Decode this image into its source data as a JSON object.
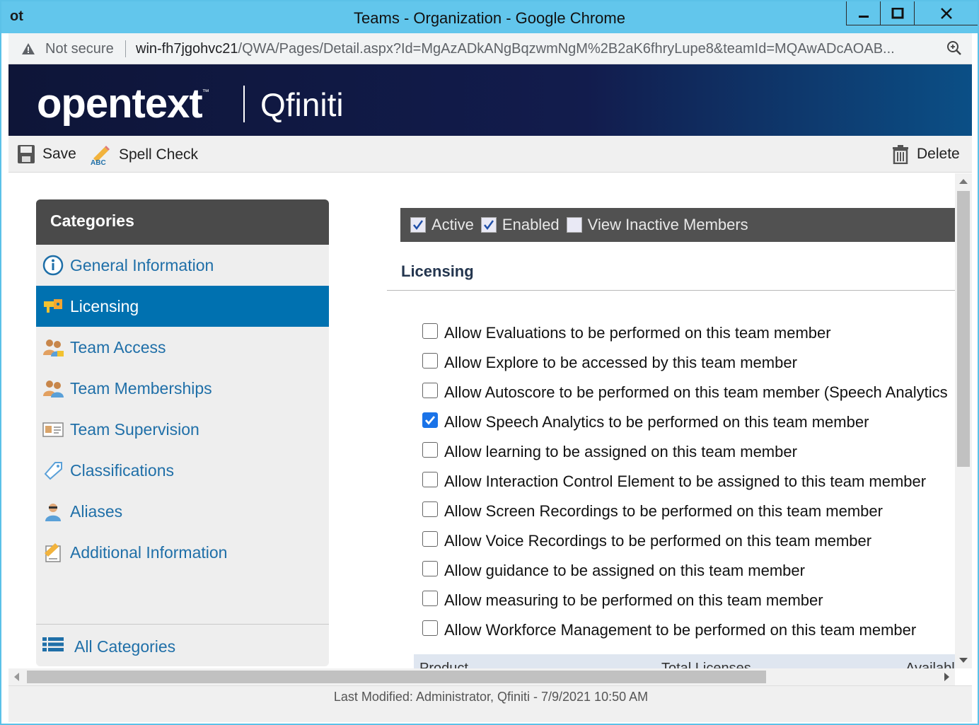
{
  "window": {
    "app_logo": "ot",
    "title": "Teams - Organization - Google Chrome"
  },
  "address": {
    "security_label": "Not secure",
    "url_host": "win-fh7jgohvc21",
    "url_path": "/QWA/Pages/Detail.aspx?Id=MgAzADkANgBqzwmNgM%2B2aK6fhryLupe8&teamId=MQAwADcAOAB..."
  },
  "brand": {
    "name": "opentext",
    "tm": "™",
    "product": "Qfiniti"
  },
  "toolbar": {
    "save_label": "Save",
    "spell_label": "Spell Check",
    "delete_label": "Delete"
  },
  "categories": {
    "header": "Categories",
    "items": [
      {
        "label": "General Information",
        "icon": "info-icon"
      },
      {
        "label": "Licensing",
        "icon": "license-key-icon",
        "active": true
      },
      {
        "label": "Team Access",
        "icon": "team-access-icon"
      },
      {
        "label": "Team Memberships",
        "icon": "team-memberships-icon"
      },
      {
        "label": "Team Supervision",
        "icon": "id-card-icon"
      },
      {
        "label": "Classifications",
        "icon": "tag-icon"
      },
      {
        "label": "Aliases",
        "icon": "alias-user-icon"
      },
      {
        "label": "Additional Information",
        "icon": "edit-note-icon"
      }
    ],
    "all_label": "All Categories"
  },
  "status": {
    "active_label": "Active",
    "enabled_label": "Enabled",
    "inactive_label": "View Inactive Members"
  },
  "licensing": {
    "title": "Licensing",
    "options": [
      {
        "label": "Allow Evaluations to be performed on this team member",
        "checked": false
      },
      {
        "label": "Allow Explore to be accessed by this team member",
        "checked": false
      },
      {
        "label": "Allow Autoscore to be performed on this team member (Speech Analytics",
        "checked": false
      },
      {
        "label": "Allow Speech Analytics to be performed on this team member",
        "checked": true
      },
      {
        "label": "Allow learning to be assigned on this team member",
        "checked": false
      },
      {
        "label": "Allow Interaction Control Element to be assigned to this team member",
        "checked": false
      },
      {
        "label": "Allow Screen Recordings to be performed on this team member",
        "checked": false
      },
      {
        "label": "Allow Voice Recordings to be performed on this team member",
        "checked": false
      },
      {
        "label": "Allow guidance to be assigned on this team member",
        "checked": false
      },
      {
        "label": "Allow measuring to be performed on this team member",
        "checked": false
      },
      {
        "label": "Allow Workforce Management to be performed on this team member",
        "checked": false
      }
    ],
    "table_headers": [
      "Product",
      "Total Licenses",
      "Availabl"
    ]
  },
  "footer": {
    "last_modified": "Last Modified: Administrator, Qfiniti - 7/9/2021 10:50 AM"
  }
}
